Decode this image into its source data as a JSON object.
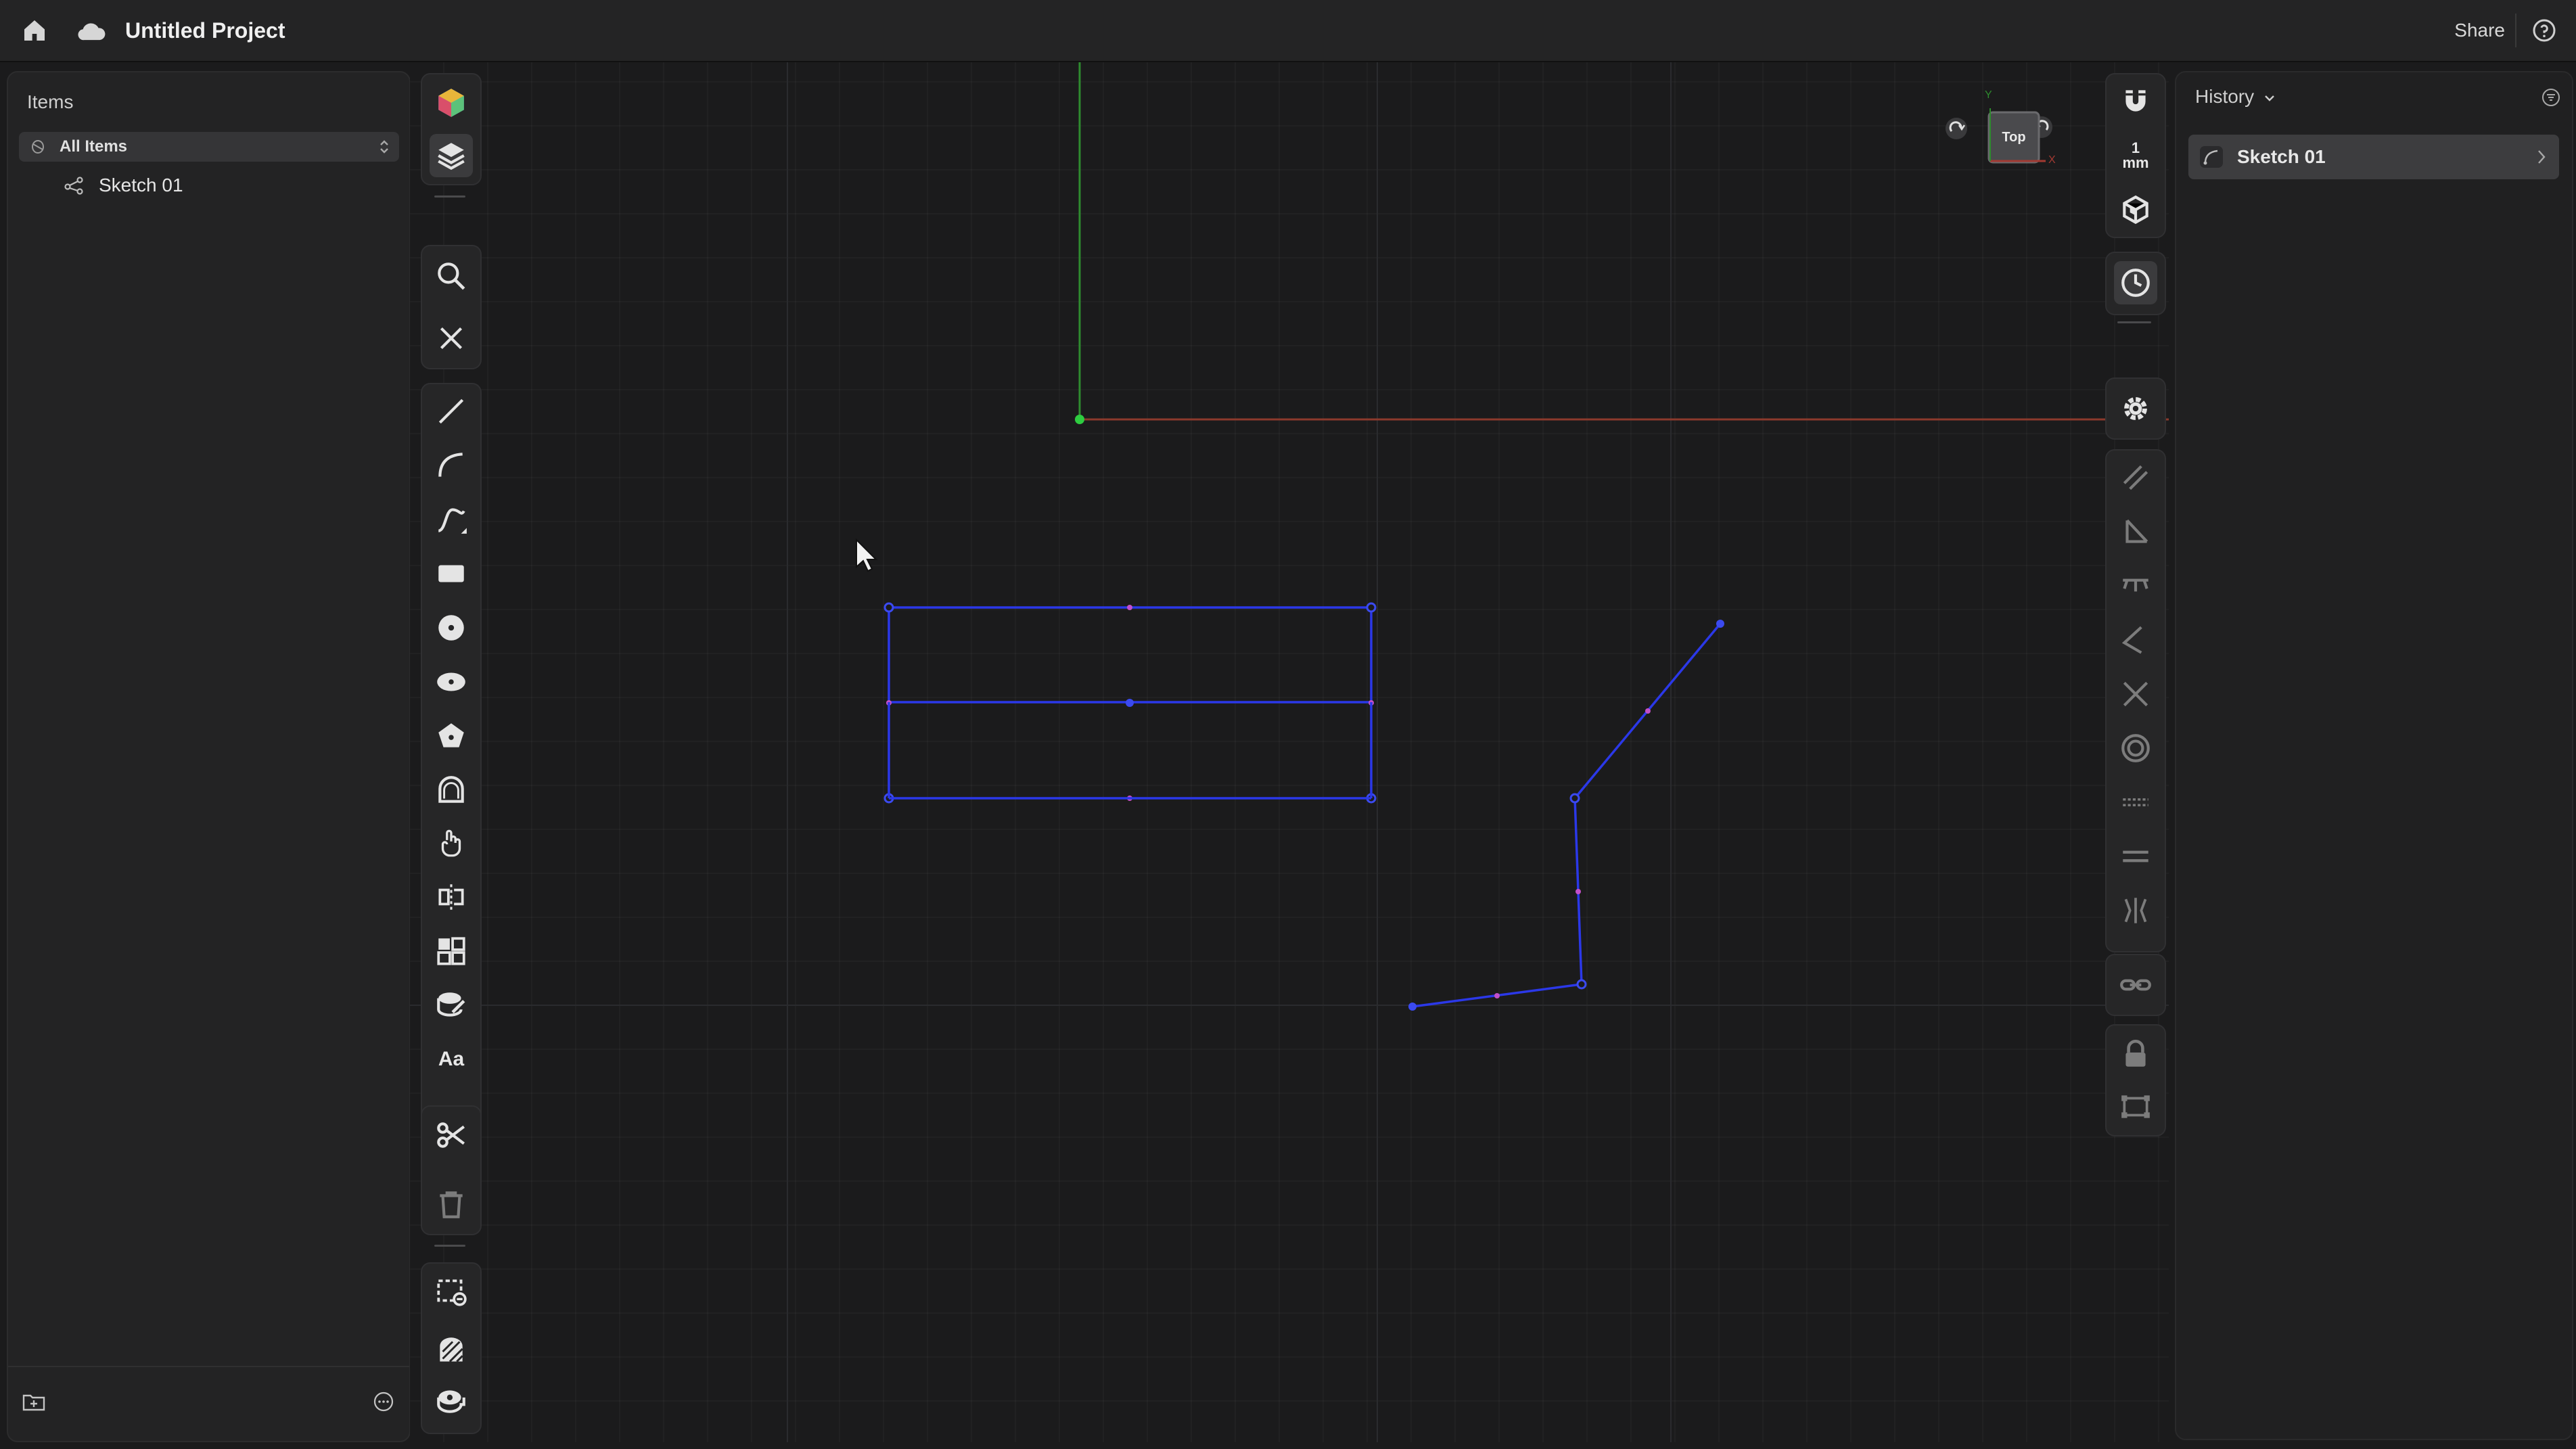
{
  "topbar": {
    "project_title": "Untitled Project",
    "share_label": "Share",
    "icons": [
      "home-icon",
      "cloud-icon",
      "help-icon"
    ]
  },
  "items_panel": {
    "heading": "Items",
    "filter_label": "All Items",
    "items": [
      {
        "label": "Sketch 01",
        "icon": "sketch-icon"
      }
    ],
    "footer_icons": [
      "new-folder-icon",
      "more-icon"
    ]
  },
  "left_toolbar": {
    "tools": [
      "material-icon",
      "layers-icon",
      "search-icon",
      "close-icon",
      "line-icon",
      "arc-icon",
      "spline-icon",
      "rectangle-icon",
      "circle-icon",
      "ellipse-icon",
      "polygon-icon",
      "slot-icon",
      "move-icon",
      "mirror-icon",
      "pattern-icon",
      "offset-icon",
      "text-icon",
      "trim-icon",
      "delete-icon",
      "select-box-icon",
      "hatch-icon",
      "measure-icon"
    ],
    "text_tool_label": "Aa"
  },
  "view_cube": {
    "label": "Top",
    "axis_y": "Y",
    "axis_x": "X"
  },
  "right_toolbar": {
    "unit_label": "1\nmm",
    "tools": [
      "snap-icon",
      "unit-icon",
      "view-cube-icon",
      "history-icon",
      "settings-icon",
      "parallel-constraint-icon",
      "perpendicular-constraint-icon",
      "horizontal-constraint-icon",
      "angle-constraint-icon",
      "coincident-constraint-icon",
      "concentric-constraint-icon",
      "tangent-constraint-icon",
      "equal-constraint-icon",
      "symmetric-constraint-icon",
      "link-icon",
      "lock-icon",
      "bounding-box-icon"
    ]
  },
  "history_panel": {
    "title": "History",
    "items": [
      {
        "label": "Sketch 01",
        "icon": "sketch-icon"
      }
    ]
  },
  "colors": {
    "accent": "#2f3fe6",
    "sketch_line": "#2b38e8",
    "midpoint": "#c24fc9",
    "y_axis": "#2e8b2e",
    "x_axis": "#8c3a2c",
    "origin": "#2ecc40"
  }
}
